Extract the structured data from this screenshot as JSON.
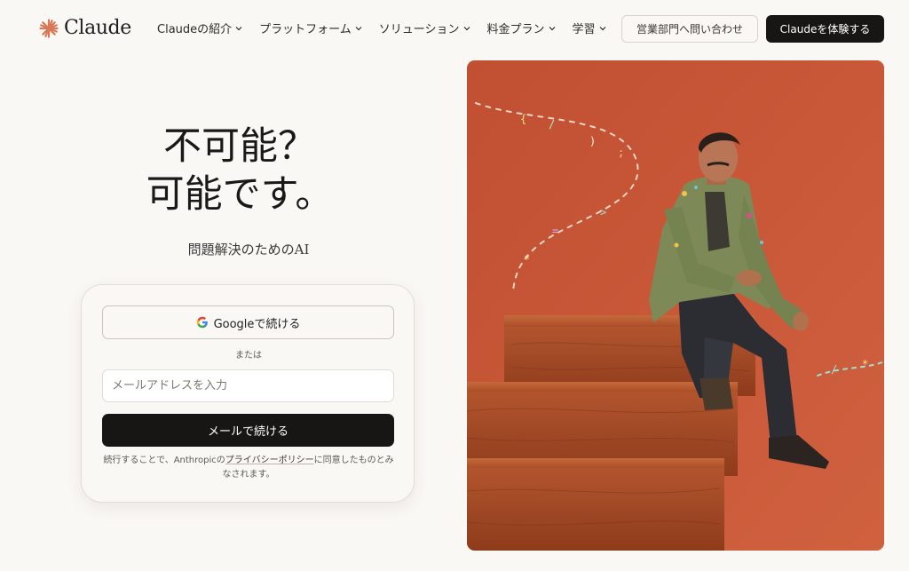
{
  "brand": {
    "name": "Claude",
    "accent_color": "#d97757",
    "logo_icon": "claude-sunburst-icon"
  },
  "nav": {
    "items": [
      {
        "label": "Claudeの紹介",
        "icon": "chevron-down-icon"
      },
      {
        "label": "プラットフォーム",
        "icon": "chevron-down-icon"
      },
      {
        "label": "ソリューション",
        "icon": "chevron-down-icon"
      },
      {
        "label": "料金プラン",
        "icon": "chevron-down-icon"
      },
      {
        "label": "学習",
        "icon": "chevron-down-icon"
      }
    ],
    "contact_label": "営業部門へ問い合わせ",
    "try_label": "Claudeを体験する"
  },
  "hero": {
    "headline_line1": "不可能？",
    "headline_line2": "可能です。",
    "subheadline": "問題解決のためのAI"
  },
  "login": {
    "google_label": "Googleで続ける",
    "google_icon": "google-g-icon",
    "or_label": "または",
    "email_placeholder": "メールアドレスを入力",
    "email_value": "",
    "email_button_label": "メールで続ける",
    "legal_prefix": "続行することで、Anthropicの",
    "legal_link": "プライバシーポリシー",
    "legal_suffix": "に同意したものとみなされます。"
  },
  "colors": {
    "page_background": "#faf8f5",
    "primary_button": "#171615",
    "hero_image_background": "#c85a3a"
  }
}
